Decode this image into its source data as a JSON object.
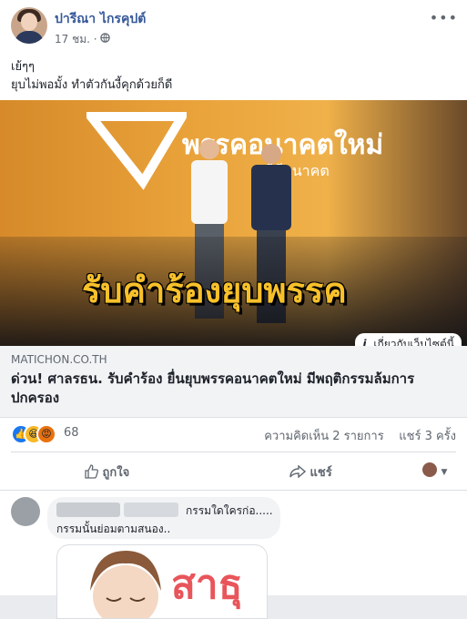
{
  "post": {
    "author": "ปารีณา ไกรคุปต์",
    "time": "17 ชม.",
    "privacy_icon": "globe-icon",
    "more_icon": "more-dots-icon",
    "text_line1": "เย้ๆๆ",
    "text_line2": "ยุบไม่พอมั้ง ทำตัวกันงี้คุกด้วยก็ดี"
  },
  "image": {
    "logo_text": "พรรคอนาคตใหม่",
    "logo_sub": "ที่มีอนาคต",
    "caption": "รับคำร้องยุบพรรค",
    "site_chip": "เกี่ยวกับเว็บไซต์นี้",
    "colors": {
      "accent": "#f39c1e",
      "caption": "#f8c12a"
    }
  },
  "link": {
    "domain": "MATICHON.CO.TH",
    "headline": "ด่วน! ศาลรธน. รับคำร้อง ยื่นยุบพรรคอนาคตใหม่ มีพฤติกรรมล้มการปกครอง"
  },
  "engagement": {
    "reaction_icons": [
      "like-icon",
      "haha-icon",
      "angry-icon"
    ],
    "reaction_count": "68",
    "comments": "ความคิดเห็น 2 รายการ",
    "shares": "แชร์ 3 ครั้ง"
  },
  "actions": {
    "like": "ถูกใจ",
    "share": "แชร์"
  },
  "comment": {
    "line1": "กรรมใดใครก่อ.....",
    "line2": "กรรมนั้นย่อมตามสนอง..",
    "sticker_text": "สาธุ"
  }
}
